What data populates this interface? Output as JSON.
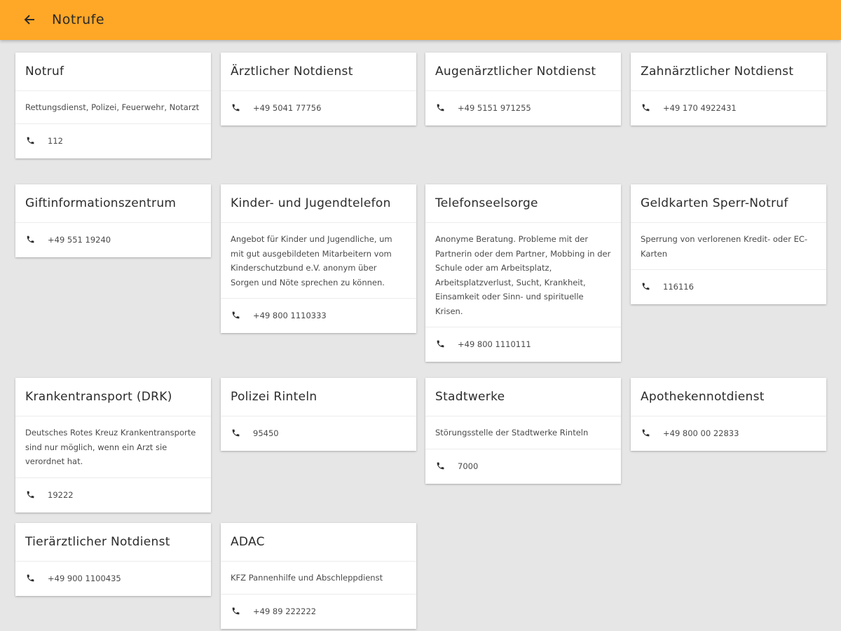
{
  "appbar": {
    "title": "Notrufe",
    "color": "#ffa726"
  },
  "icons": {
    "back": "arrow-back-icon",
    "phone": "phone-icon"
  },
  "cards": [
    {
      "title": "Notruf",
      "description": "Rettungsdienst, Polizei, Feuerwehr, Notarzt",
      "phone": "112"
    },
    {
      "title": "Ärztlicher Notdienst",
      "description": "",
      "phone": "+49 5041 77756"
    },
    {
      "title": "Augenärztlicher Notdienst",
      "description": "",
      "phone": "+49 5151 971255"
    },
    {
      "title": "Zahnärztlicher Notdienst",
      "description": "",
      "phone": "+49 170 4922431"
    },
    {
      "title": "Giftinformationszentrum",
      "description": "",
      "phone": "+49 551 19240"
    },
    {
      "title": "Kinder- und Jugendtelefon",
      "description": "Angebot für Kinder und Jugendliche, um mit gut ausgebildeten Mitarbeitern vom Kinderschutzbund e.V. anonym über Sorgen und Nöte sprechen zu können.",
      "phone": "+49 800 1110333"
    },
    {
      "title": "Telefonseelsorge",
      "description": "Anonyme Beratung. Probleme mit der Partnerin oder dem Partner, Mobbing in der Schule oder am Arbeitsplatz, Arbeitsplatzverlust, Sucht, Krankheit, Einsamkeit oder Sinn- und spirituelle Krisen.",
      "phone": "+49 800 1110111"
    },
    {
      "title": "Geldkarten Sperr-Notruf",
      "description": "Sperrung von verlorenen Kredit- oder EC-Karten",
      "phone": "116116"
    },
    {
      "title": "Krankentransport (DRK)",
      "description": "Deutsches Rotes Kreuz Krankentransporte sind nur möglich, wenn ein Arzt sie verordnet hat.",
      "phone": "19222"
    },
    {
      "title": "Polizei Rinteln",
      "description": "",
      "phone": "95450"
    },
    {
      "title": "Stadtwerke",
      "description": "Störungsstelle der Stadtwerke Rinteln",
      "phone": "7000"
    },
    {
      "title": "Apothekennotdienst",
      "description": "",
      "phone": "+49 800 00 22833"
    },
    {
      "title": "Tierärztlicher Notdienst",
      "description": "",
      "phone": "+49 900 1100435"
    },
    {
      "title": "ADAC",
      "description": "KFZ Pannenhilfe und Abschleppdienst",
      "phone": "+49 89 222222"
    }
  ]
}
